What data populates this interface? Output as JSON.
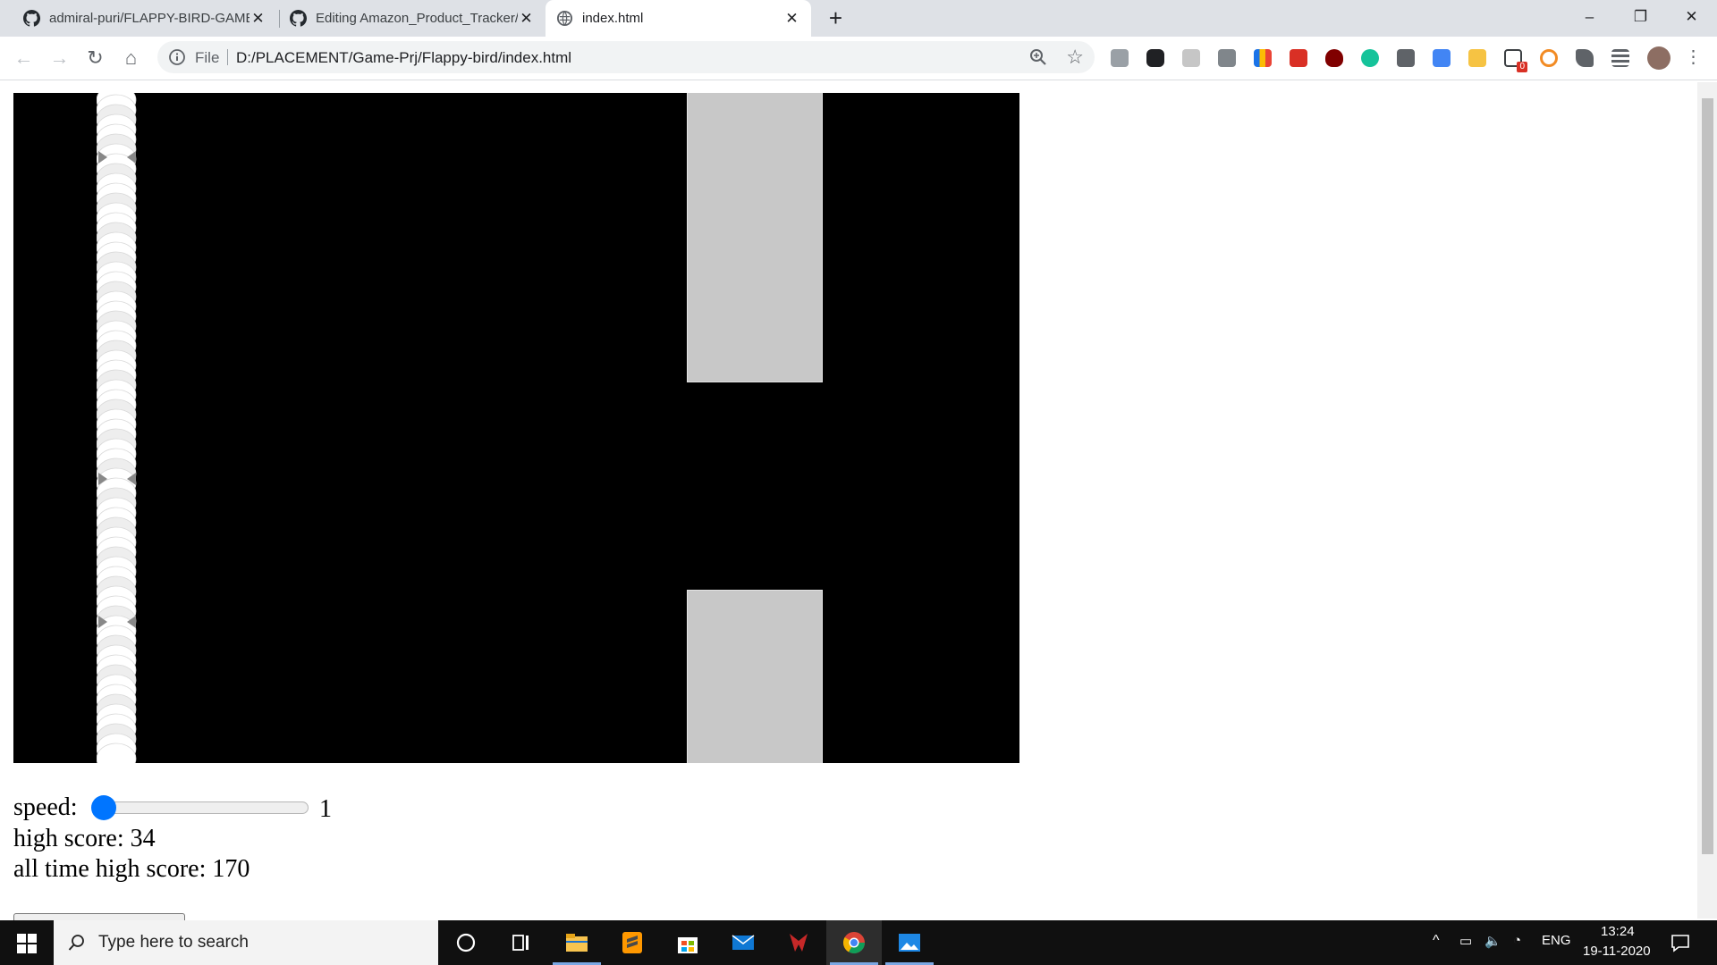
{
  "browser": {
    "tabs": [
      {
        "title": "admiral-puri/FLAPPY-BIRD-GAME",
        "favicon": "github-icon",
        "active": false
      },
      {
        "title": "Editing Amazon_Product_Tracker/",
        "favicon": "github-icon",
        "active": false
      },
      {
        "title": "index.html",
        "favicon": "globe-icon",
        "active": true
      }
    ],
    "new_tab_label": "+",
    "address_bar": {
      "scheme_label": "File",
      "url": "D:/PLACEMENT/Game-Prj/Flappy-bird/index.html"
    },
    "extension_badge": "0",
    "window_controls": {
      "minimize": "–",
      "restore": "❐",
      "close": "✕"
    }
  },
  "page": {
    "game": {
      "background": "#000000",
      "pipe_color": "#c8c8c8",
      "bird_color": "#ffffff"
    },
    "controls": {
      "speed_label": "speed:",
      "speed_value": "1",
      "speed_fraction": 0,
      "high_score_text": "high score: 34",
      "all_time_high_score_text": "all time high score: 170"
    }
  },
  "taskbar": {
    "search_placeholder": "Type here to search",
    "language": "ENG",
    "time": "13:24",
    "date": "19-11-2020"
  }
}
